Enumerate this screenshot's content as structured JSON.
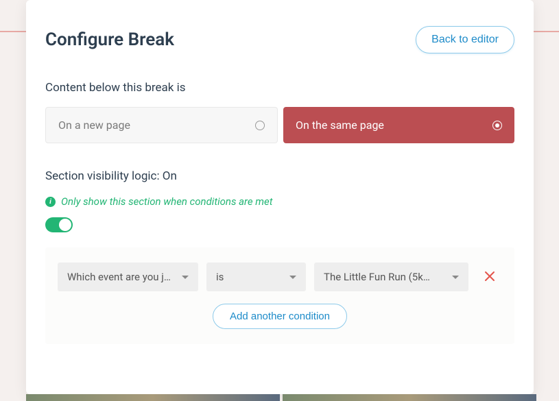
{
  "header": {
    "title": "Configure Break",
    "back_label": "Back to editor"
  },
  "content_section": {
    "label": "Content below this break is",
    "options": {
      "new_page": "On a new page",
      "same_page": "On the same page"
    },
    "selected": "same_page"
  },
  "visibility": {
    "label": "Section visibility logic: On",
    "hint": "Only show this section when conditions are met",
    "toggle_on": true
  },
  "conditions": {
    "row": {
      "field": "Which event are you jo…",
      "operator": "is",
      "value": "The Little Fun Run (5k…"
    },
    "add_label": "Add another condition"
  },
  "colors": {
    "accent_red": "#bb4e52",
    "accent_blue": "#1d8bc9",
    "accent_green": "#22b574"
  }
}
